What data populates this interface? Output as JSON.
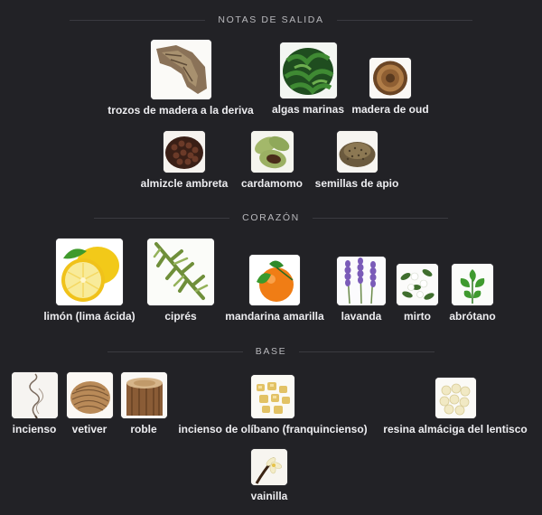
{
  "sections": {
    "top": {
      "title": "NOTAS DE SALIDA"
    },
    "heart": {
      "title": "CORAZÓN"
    },
    "base": {
      "title": "BASE"
    }
  },
  "notes": {
    "driftwood": {
      "label": "trozos de madera a la deriva",
      "icon": "driftwood-icon"
    },
    "seaweed": {
      "label": "algas marinas",
      "icon": "seaweed-icon"
    },
    "oud": {
      "label": "madera de oud",
      "icon": "oud-wood-icon"
    },
    "ambrette": {
      "label": "almizcle ambreta",
      "icon": "ambrette-seeds-icon"
    },
    "cardamom": {
      "label": "cardamomo",
      "icon": "cardamom-icon"
    },
    "celery": {
      "label": "semillas de apio",
      "icon": "celery-seeds-icon"
    },
    "lime": {
      "label": "limón (lima ácida)",
      "icon": "lemon-icon"
    },
    "cypress": {
      "label": "ciprés",
      "icon": "cypress-icon"
    },
    "mandarin": {
      "label": "mandarina amarilla",
      "icon": "mandarin-icon"
    },
    "lavender": {
      "label": "lavanda",
      "icon": "lavender-icon"
    },
    "myrtle": {
      "label": "mirto",
      "icon": "myrtle-icon"
    },
    "southernwood": {
      "label": "abrótano",
      "icon": "southernwood-icon"
    },
    "incense": {
      "label": "incienso",
      "icon": "incense-smoke-icon"
    },
    "vetiver": {
      "label": "vetiver",
      "icon": "vetiver-roots-icon"
    },
    "oak": {
      "label": "roble",
      "icon": "oak-log-icon"
    },
    "olibanum": {
      "label": "incienso de olíbano (franquincienso)",
      "icon": "olibanum-resin-icon"
    },
    "mastic": {
      "label": "resina almáciga del lentisco",
      "icon": "mastic-resin-icon"
    },
    "vanilla": {
      "label": "vainilla",
      "icon": "vanilla-flower-icon"
    }
  }
}
